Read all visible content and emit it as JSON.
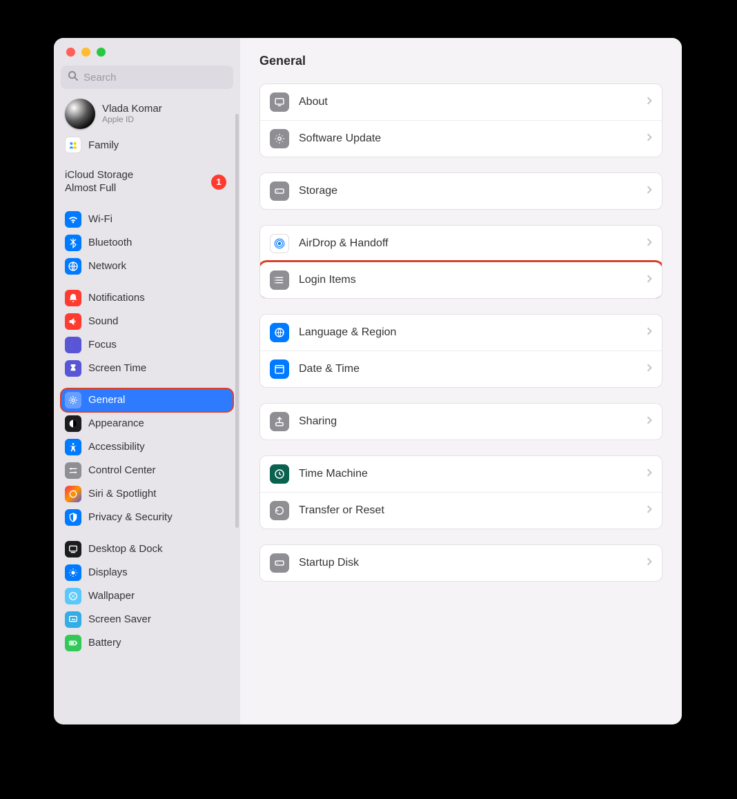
{
  "window": {
    "title": "General"
  },
  "search": {
    "placeholder": "Search"
  },
  "account": {
    "name": "Vlada Komar",
    "sub": "Apple ID"
  },
  "family": {
    "label": "Family"
  },
  "storageAlert": {
    "line1": "iCloud Storage",
    "line2": "Almost Full",
    "badge": "1"
  },
  "sidebar": {
    "groupA": [
      {
        "label": "Wi-Fi"
      },
      {
        "label": "Bluetooth"
      },
      {
        "label": "Network"
      }
    ],
    "groupB": [
      {
        "label": "Notifications"
      },
      {
        "label": "Sound"
      },
      {
        "label": "Focus"
      },
      {
        "label": "Screen Time"
      }
    ],
    "groupC": [
      {
        "label": "General"
      },
      {
        "label": "Appearance"
      },
      {
        "label": "Accessibility"
      },
      {
        "label": "Control Center"
      },
      {
        "label": "Siri & Spotlight"
      },
      {
        "label": "Privacy & Security"
      }
    ],
    "groupD": [
      {
        "label": "Desktop & Dock"
      },
      {
        "label": "Displays"
      },
      {
        "label": "Wallpaper"
      },
      {
        "label": "Screen Saver"
      },
      {
        "label": "Battery"
      }
    ]
  },
  "main": {
    "group1": [
      {
        "label": "About"
      },
      {
        "label": "Software Update"
      }
    ],
    "group2": [
      {
        "label": "Storage"
      }
    ],
    "group3": [
      {
        "label": "AirDrop & Handoff"
      },
      {
        "label": "Login Items"
      }
    ],
    "group4": [
      {
        "label": "Language & Region"
      },
      {
        "label": "Date & Time"
      }
    ],
    "group5": [
      {
        "label": "Sharing"
      }
    ],
    "group6": [
      {
        "label": "Time Machine"
      },
      {
        "label": "Transfer or Reset"
      }
    ],
    "group7": [
      {
        "label": "Startup Disk"
      }
    ]
  }
}
